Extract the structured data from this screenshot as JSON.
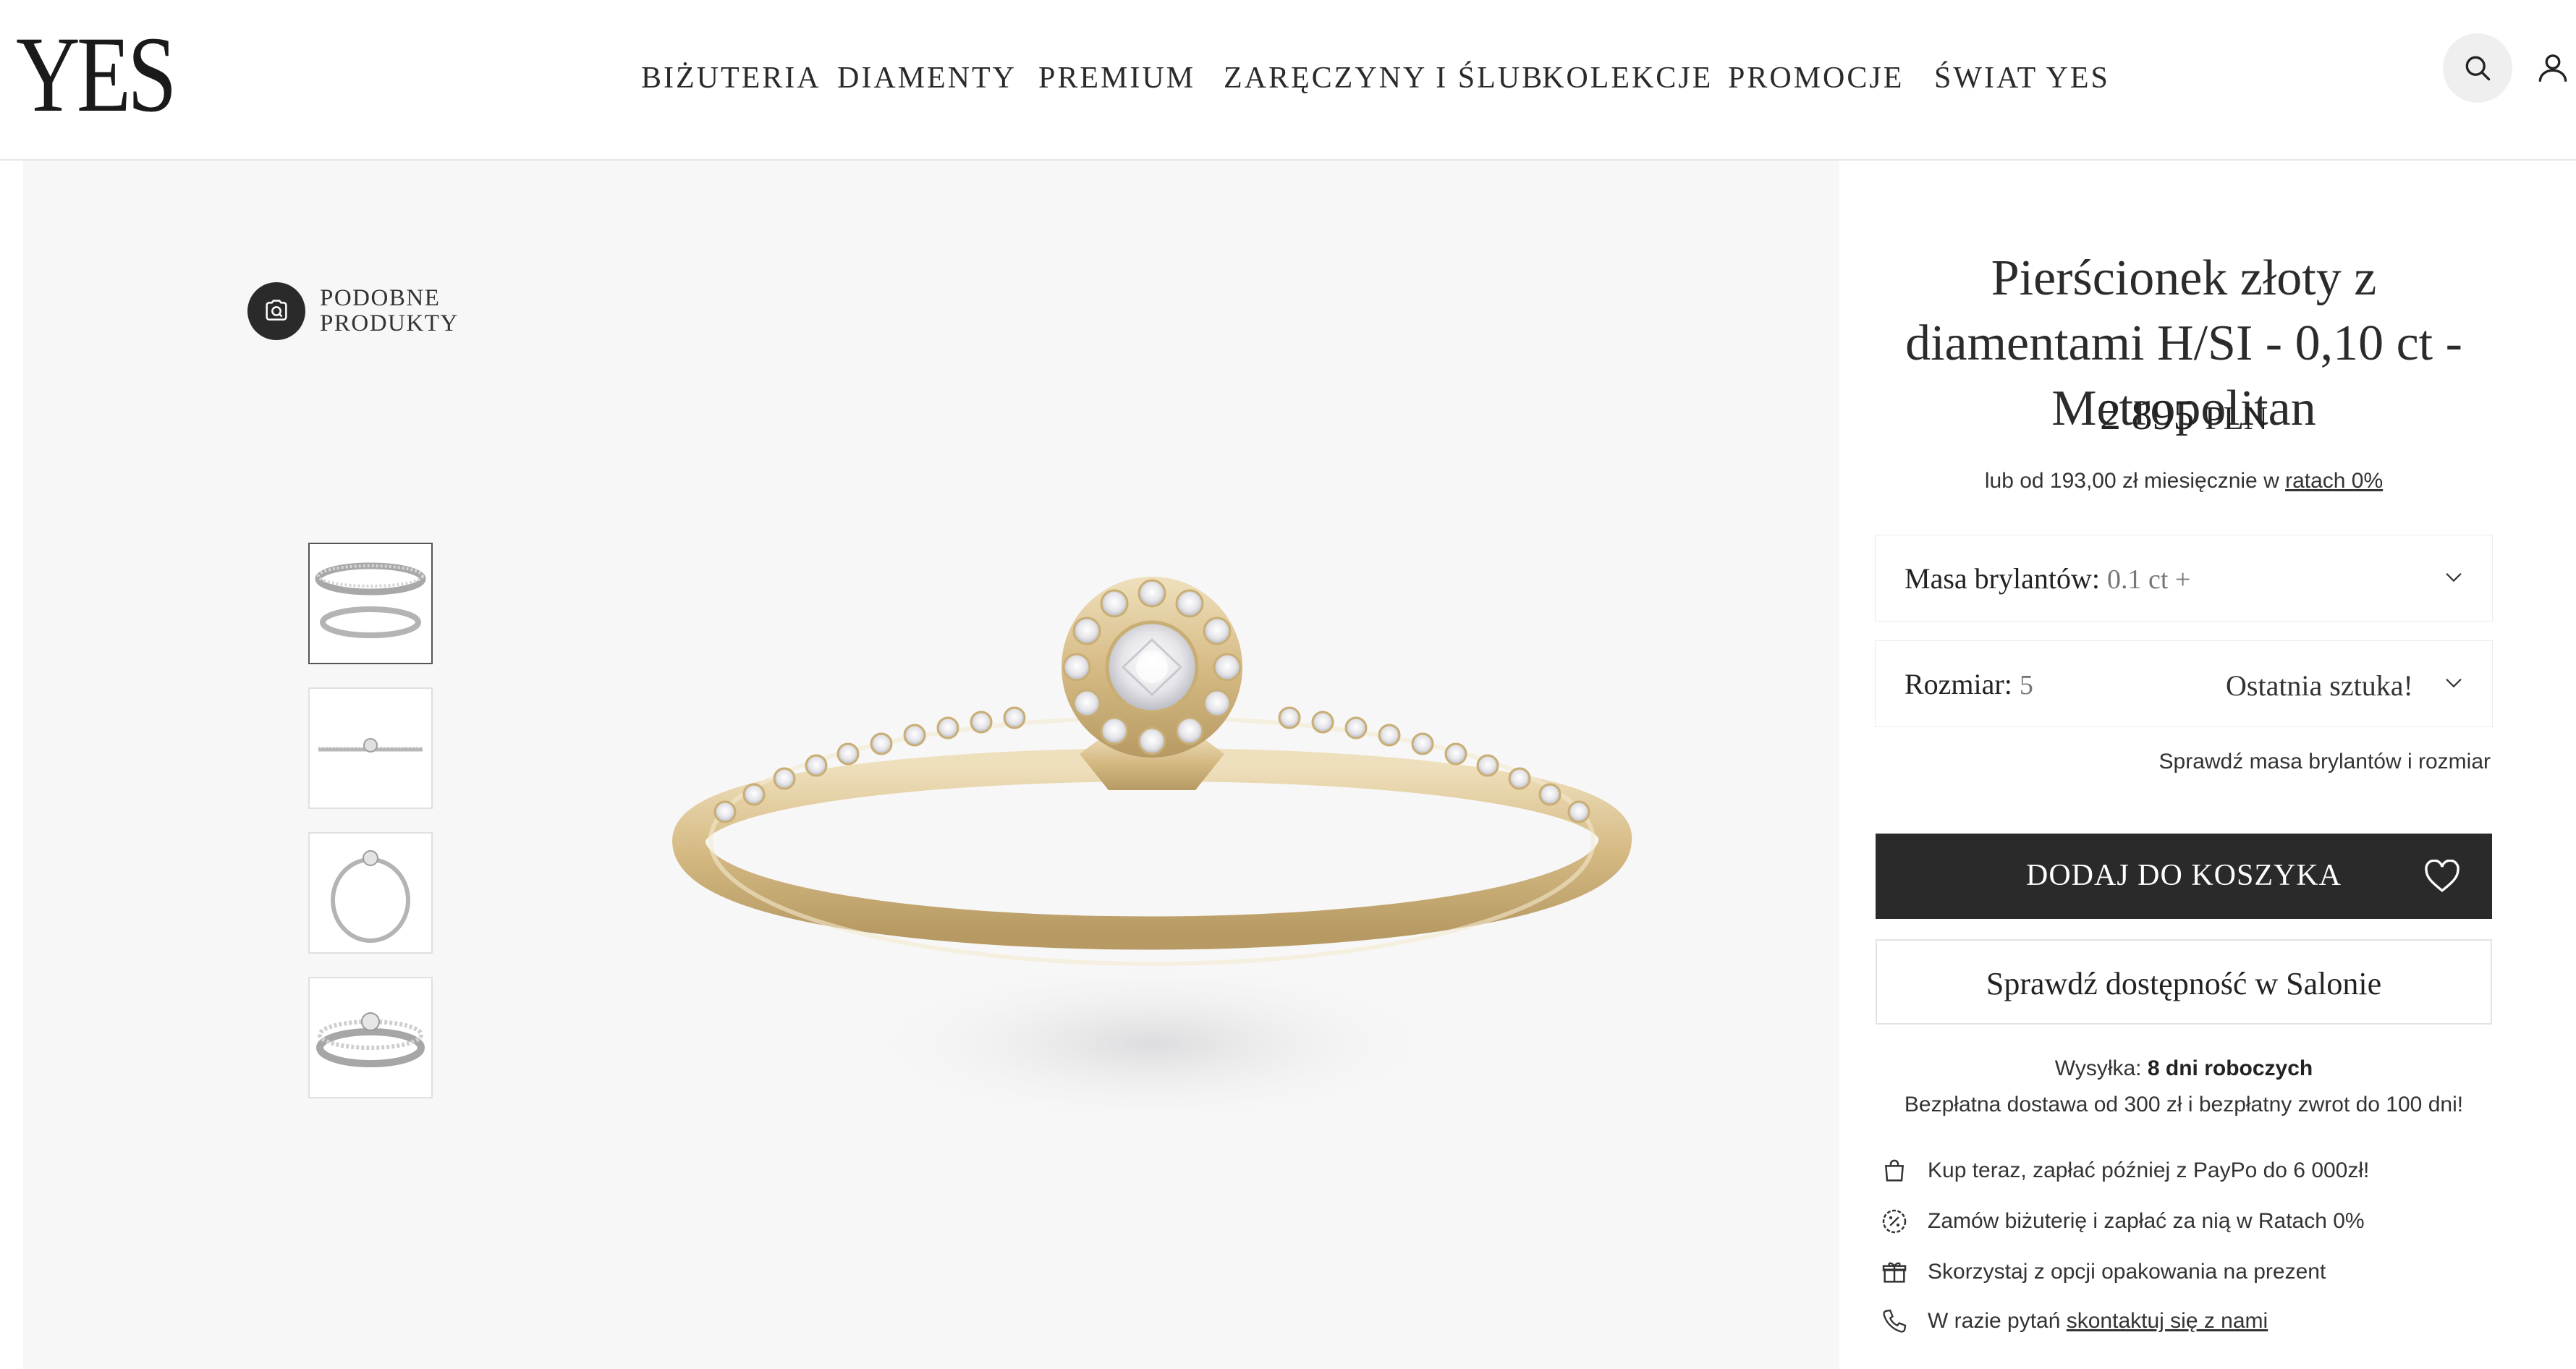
{
  "header": {
    "logo": "YES",
    "nav": [
      "BIŻUTERIA",
      "DIAMENTY",
      "PREMIUM",
      "ZARĘCZYNY I ŚLUB",
      "KOLEKCJE",
      "PROMOCJE",
      "ŚWIAT YES"
    ],
    "icons": [
      "search-icon",
      "user-icon"
    ]
  },
  "gallery": {
    "similar_products": "PODOBNE\nPRODUKTY",
    "thumbnails_count": 4,
    "active_thumbnail": 1
  },
  "product": {
    "title": "Pierścionek złoty z diamentami H/SI - 0,10 ct - Metropolitan",
    "price": "2 895",
    "currency": "PLN",
    "installment_prefix": "lub od 193,00 zł miesięcznie w",
    "installment_link": "ratach 0%",
    "carat_label": "Masa brylantów:",
    "carat_value": "0.1 ct +",
    "size_label": "Rozmiar:",
    "size_value": "5",
    "size_note": "Ostatnia sztuka!",
    "check_link": "Sprawdź masa brylantów i rozmiar",
    "add_to_cart": "DODAJ DO KOSZYKA",
    "check_salon": "Sprawdź dostępność w Salonie",
    "shipping_label": "Wysyłka:",
    "shipping_value": "8 dni roboczych",
    "delivery_info": "Bezpłatna dostawa od 300 zł i bezpłatny zwrot do 100 dni!",
    "features": [
      {
        "icon": "bag-icon",
        "text": "Kup teraz, zapłać później z PayPo do 6 000zł!"
      },
      {
        "icon": "percent-badge-icon",
        "text": "Zamów biżuterię i zapłać za nią w Ratach 0%"
      },
      {
        "icon": "gift-icon",
        "text": "Skorzystaj z opcji opakowania na prezent"
      },
      {
        "icon": "phone-icon",
        "text_prefix": "W razie pytań",
        "link": "skontaktuj się z nami"
      }
    ]
  },
  "colors": {
    "accent_dark": "#2a2a2a",
    "gallery_bg": "#f7f7f8",
    "gold": "#d9c08c"
  }
}
